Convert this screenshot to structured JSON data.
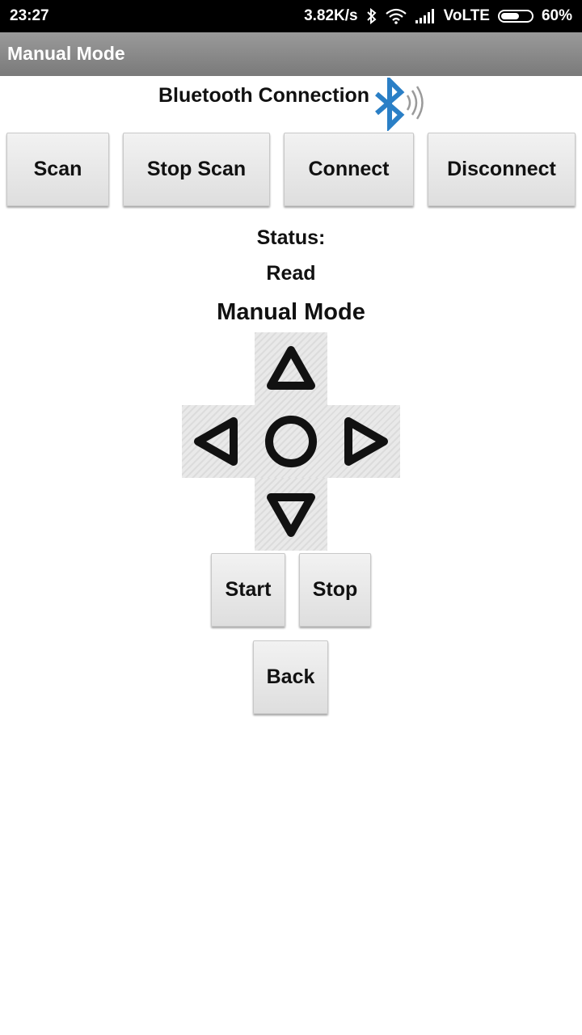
{
  "status_bar": {
    "time": "23:27",
    "net_speed": "3.82K/s",
    "network": "VoLTE",
    "battery_text": "60%",
    "battery_level": 0.6
  },
  "title_bar": {
    "title": "Manual Mode"
  },
  "bluetooth": {
    "heading": "Bluetooth Connection",
    "icon": "bluetooth-icon",
    "icon_color": "#2a7fc6"
  },
  "connection_buttons": [
    {
      "label": "Scan"
    },
    {
      "label": "Stop Scan"
    },
    {
      "label": "Connect"
    },
    {
      "label": "Disconnect"
    }
  ],
  "status": {
    "label": "Status:",
    "value": "Read"
  },
  "manual": {
    "heading": "Manual Mode"
  },
  "dpad": {
    "up": "up-arrow-icon",
    "down": "down-arrow-icon",
    "left": "left-arrow-icon",
    "right": "right-arrow-icon",
    "center": "circle-icon"
  },
  "controls": {
    "start": "Start",
    "stop": "Stop",
    "back": "Back"
  }
}
